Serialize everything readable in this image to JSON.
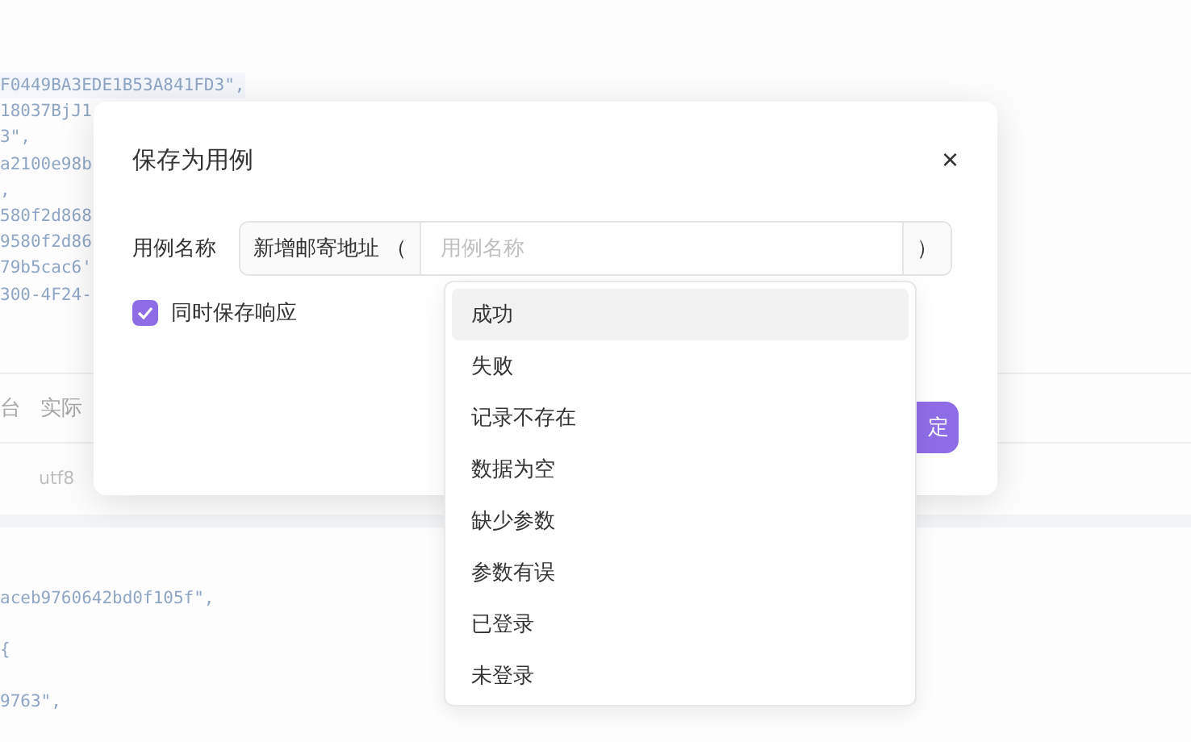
{
  "background": {
    "code_top": [
      "F0449BA3EDE1B53A841FD3\",",
      "18037BjJ1",
      "3\",",
      "a2100e98b",
      ",",
      "580f2d868",
      "9580f2d86",
      "79b5cac6'",
      "300-4F24-"
    ],
    "tabs": [
      {
        "label": "台",
        "selected": false
      },
      {
        "label": "实际",
        "selected": false
      }
    ],
    "encoding": "utf8",
    "code_bottom": [
      "aceb9760642bd0f105f\",",
      "{",
      "9763\","
    ]
  },
  "dialog": {
    "title": "保存为用例",
    "close": "×",
    "name_label": "用例名称",
    "prefix": "新增邮寄地址 （",
    "placeholder": "用例名称",
    "suffix": "）",
    "save_response": {
      "label": "同时保存响应",
      "checked": true
    },
    "confirm": "定"
  },
  "dropdown": [
    {
      "label": "成功",
      "selected": true
    },
    {
      "label": "失败",
      "selected": false
    },
    {
      "label": "记录不存在",
      "selected": false
    },
    {
      "label": "数据为空",
      "selected": false
    },
    {
      "label": "缺少参数",
      "selected": false
    },
    {
      "label": "参数有误",
      "selected": false
    },
    {
      "label": "已登录",
      "selected": false
    },
    {
      "label": "未登录",
      "selected": false
    }
  ]
}
